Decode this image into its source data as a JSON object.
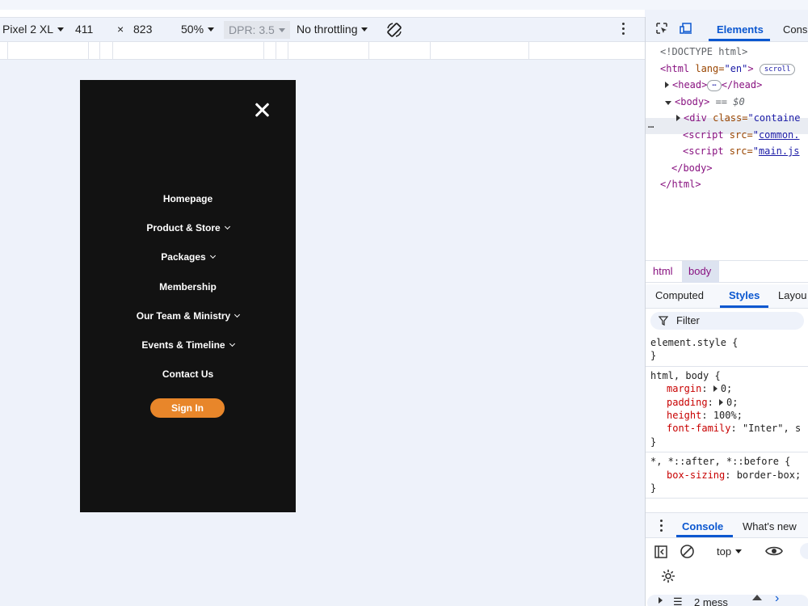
{
  "device_toolbar": {
    "device": "Pixel 2 XL",
    "width": "411",
    "times": "×",
    "height": "823",
    "zoom": "50%",
    "dpr": "DPR: 3.5",
    "throttling": "No throttling"
  },
  "viewport_menu": {
    "nav_items": [
      {
        "label": "Homepage",
        "has_chevron": false
      },
      {
        "label": "Product & Store",
        "has_chevron": true
      },
      {
        "label": "Packages",
        "has_chevron": true
      },
      {
        "label": "Membership",
        "has_chevron": false
      },
      {
        "label": "Our Team & Ministry",
        "has_chevron": true
      },
      {
        "label": "Events & Timeline",
        "has_chevron": true
      },
      {
        "label": "Contact Us",
        "has_chevron": false
      }
    ],
    "signin_label": "Sign In",
    "accent_color": "#e8862a"
  },
  "devtools": {
    "tabs": {
      "elements": "Elements",
      "console": "Cons"
    },
    "dom": {
      "doctype": "<!DOCTYPE html>",
      "html_open": "<html",
      "html_lang_attr": " lang=",
      "html_lang_val": "\"en\"",
      "html_close_bracket": ">",
      "scroll_badge": "scroll",
      "head_open": "<head>",
      "ellipsis": "⋯",
      "head_close": "</head>",
      "row_dots": "⋯",
      "body_open": "<body>",
      "body_marker": " == $0",
      "div_open": "<div",
      "div_class_attr": " class=",
      "div_class_val": "\"containe",
      "script1_open": "<script",
      "script1_src_attr": " src=",
      "script1_src_q": "\"",
      "script1_src_val": "common.",
      "script2_open": "<script",
      "script2_src_attr": " src=",
      "script2_src_q": "\"",
      "script2_src_val": "main.js",
      "body_close": "</body>",
      "html_close": "</html>"
    },
    "breadcrumbs": [
      "html",
      "body"
    ],
    "subtabs": {
      "computed": "Computed",
      "styles": "Styles",
      "layout": "Layou"
    },
    "filter_placeholder": "Filter",
    "styles": {
      "element_style_selector": "element.style {",
      "close_brace": "}",
      "rule1_selector": "html, body {",
      "rule1_props": [
        {
          "name": "margin",
          "arrow": true,
          "value": "0;"
        },
        {
          "name": "padding",
          "arrow": true,
          "value": "0;"
        },
        {
          "name": "height",
          "arrow": false,
          "value": "100%;"
        },
        {
          "name": "font-family",
          "arrow": false,
          "value": "\"Inter\", s"
        }
      ],
      "rule2_selector": "*, *::after, *::before {",
      "rule2_prop_name": "box-sizing",
      "rule2_prop_value": "border-box;"
    },
    "drawer_tabs": {
      "console": "Console",
      "whats_new": "What's new"
    },
    "console_context": "top",
    "messages_label": "2 mess"
  }
}
